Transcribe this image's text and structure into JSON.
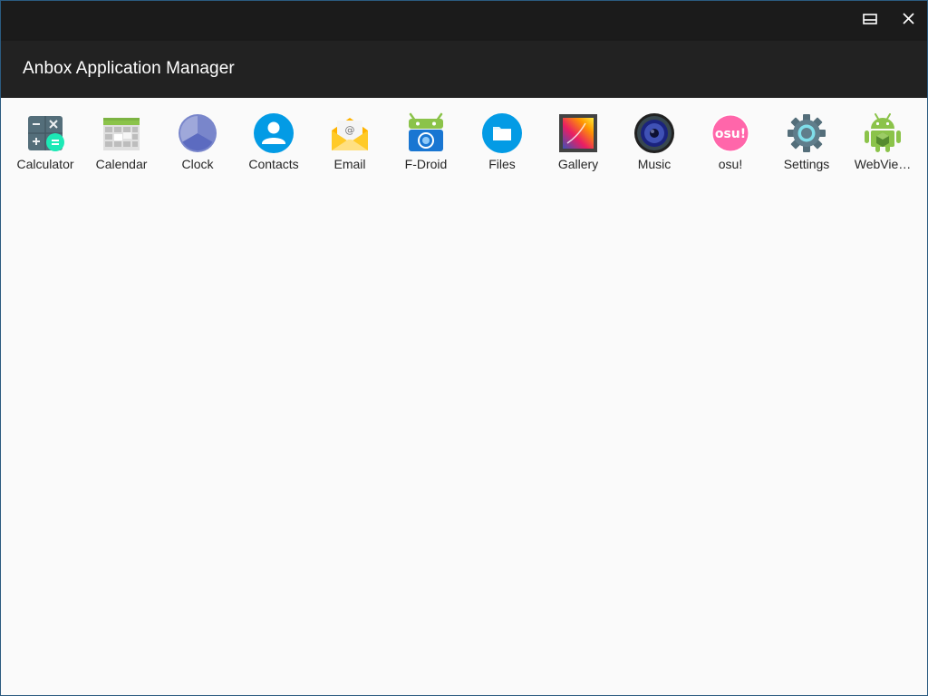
{
  "window": {
    "restore_icon": "restore-window-icon",
    "close_icon": "close-window-icon"
  },
  "appbar": {
    "title": "Anbox Application Manager"
  },
  "apps": [
    {
      "label": "Calculator",
      "icon": "calculator-icon"
    },
    {
      "label": "Calendar",
      "icon": "calendar-icon"
    },
    {
      "label": "Clock",
      "icon": "clock-icon"
    },
    {
      "label": "Contacts",
      "icon": "contacts-icon"
    },
    {
      "label": "Email",
      "icon": "email-icon"
    },
    {
      "label": "F-Droid",
      "icon": "fdroid-icon"
    },
    {
      "label": "Files",
      "icon": "files-icon"
    },
    {
      "label": "Gallery",
      "icon": "gallery-icon"
    },
    {
      "label": "Music",
      "icon": "music-icon"
    },
    {
      "label": "osu!",
      "icon": "osu-icon",
      "icon_text": "osu!"
    },
    {
      "label": "Settings",
      "icon": "settings-icon"
    },
    {
      "label": "WebVie…",
      "icon": "android-webview-icon"
    }
  ],
  "colors": {
    "titlebar": "#1b1b1b",
    "appbar": "#222222",
    "background": "#fafafa"
  }
}
